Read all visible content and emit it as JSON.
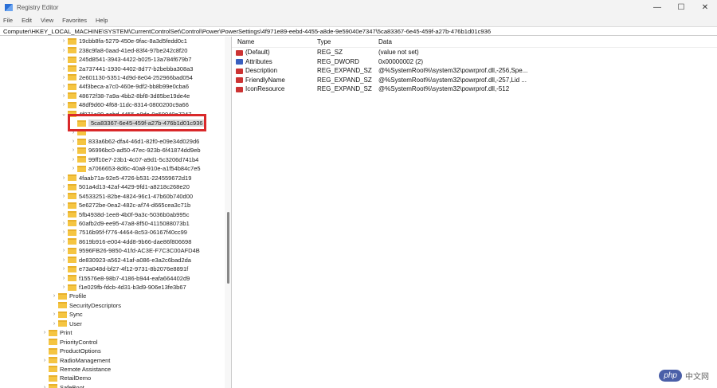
{
  "window": {
    "title": "Registry Editor",
    "controls": [
      "—",
      "☐",
      "✕"
    ]
  },
  "menu": [
    "File",
    "Edit",
    "View",
    "Favorites",
    "Help"
  ],
  "address": "Computer\\HKEY_LOCAL_MACHINE\\SYSTEM\\CurrentControlSet\\Control\\Power\\PowerSettings\\4f971e89-eebd-4455-a8de-9e59040e7347\\5ca83367-6e45-459f-a27b-476b1d01c936",
  "tree": [
    {
      "label": "19cbb8fa-5279-450e-9fac-8a3d5fedd0c1",
      "level": 3,
      "arrow": "›"
    },
    {
      "label": "238c9fa8-0aad-41ed-83f4-97be242c8f20",
      "level": 3,
      "arrow": "›"
    },
    {
      "label": "245d8541-3943-4422-b025-13a784f679b7",
      "level": 3,
      "arrow": "›"
    },
    {
      "label": "2a737441-1930-4402-8d77-b2bebba308a3",
      "level": 3,
      "arrow": "›"
    },
    {
      "label": "2e601130-5351-4d9d-8e04-252966bad054",
      "level": 3,
      "arrow": "›"
    },
    {
      "label": "44f3beca-a7c0-460e-9df2-bb8b99e0cba6",
      "level": 3,
      "arrow": "›"
    },
    {
      "label": "48672f38-7a9a-4bb2-8bf8-3d85be19de4e",
      "level": 3,
      "arrow": "›"
    },
    {
      "label": "48df9d60-4f68-11dc-8314-0800200c9a66",
      "level": 3,
      "arrow": "›"
    },
    {
      "label": "4f971e89-eebd-4455-a8de-9e59040e7347",
      "level": 3,
      "arrow": "⌄"
    },
    {
      "label": "5ca83367-6e45-459f-a27b-476b1d01c936",
      "level": 4,
      "arrow": "",
      "selected": true
    },
    {
      "label": "",
      "level": 4,
      "arrow": "›"
    },
    {
      "label": "833a6b62-dfa4-46d1-82f0-e09e34d029d6",
      "level": 4,
      "arrow": "›"
    },
    {
      "label": "96996bc0-ad50-47ec-923b-6f41874dd9eb",
      "level": 4,
      "arrow": "›"
    },
    {
      "label": "99ff10e7-23b1-4c07-a9d1-5c3206d741b4",
      "level": 4,
      "arrow": "›"
    },
    {
      "label": "a7066653-8d6c-40a8-910e-a1f54b84c7e5",
      "level": 4,
      "arrow": "›"
    },
    {
      "label": "4faab71a-92e5-4726-b531-224559672d19",
      "level": 3,
      "arrow": "›"
    },
    {
      "label": "501a4d13-42af-4429-9fd1-a8218c268e20",
      "level": 3,
      "arrow": "›"
    },
    {
      "label": "54533251-82be-4824-96c1-47b60b740d00",
      "level": 3,
      "arrow": "›"
    },
    {
      "label": "5e6272be-0ea2-482c-af74-d665cea3c71b",
      "level": 3,
      "arrow": "›"
    },
    {
      "label": "5fb4938d-1ee8-4b0f-9a3c-5036b0ab995c",
      "level": 3,
      "arrow": "›"
    },
    {
      "label": "60afb2d9-ee95-47a8-8f50-4115088073b1",
      "level": 3,
      "arrow": "›"
    },
    {
      "label": "7516b95f-f776-4464-8c53-06167f40cc99",
      "level": 3,
      "arrow": "›"
    },
    {
      "label": "8619b916-e004-4dd8-9b66-dae86f806698",
      "level": 3,
      "arrow": "›"
    },
    {
      "label": "9596FB26-9850-41fd-AC3E-F7C3C00AFD4B",
      "level": 3,
      "arrow": "›"
    },
    {
      "label": "de830923-a562-41af-a086-e3a2c6bad2da",
      "level": 3,
      "arrow": "›"
    },
    {
      "label": "e73a048d-bf27-4f12-9731-8b2076e8891f",
      "level": 3,
      "arrow": "›"
    },
    {
      "label": "f15576e8-98b7-4186-b944-eafa664402d9",
      "level": 3,
      "arrow": "›"
    },
    {
      "label": "f1e029fb-fdcb-4d31-b3d9-906e13fe3b67",
      "level": 3,
      "arrow": "›"
    },
    {
      "label": "Profile",
      "level": 2,
      "arrow": "›"
    },
    {
      "label": "SecurityDescriptors",
      "level": 2,
      "arrow": ""
    },
    {
      "label": "Sync",
      "level": 2,
      "arrow": "›"
    },
    {
      "label": "User",
      "level": 2,
      "arrow": "›"
    },
    {
      "label": "Print",
      "level": 1,
      "arrow": "›"
    },
    {
      "label": "PriorityControl",
      "level": 1,
      "arrow": ""
    },
    {
      "label": "ProductOptions",
      "level": 1,
      "arrow": ""
    },
    {
      "label": "RadioManagement",
      "level": 1,
      "arrow": "›"
    },
    {
      "label": "Remote Assistance",
      "level": 1,
      "arrow": ""
    },
    {
      "label": "RetailDemo",
      "level": 1,
      "arrow": ""
    },
    {
      "label": "SafeBoot",
      "level": 1,
      "arrow": "›"
    }
  ],
  "values": {
    "headers": [
      "Name",
      "Type",
      "Data"
    ],
    "rows": [
      {
        "name": "(Default)",
        "type": "REG_SZ",
        "data": "(value not set)",
        "icon": "string"
      },
      {
        "name": "Attributes",
        "type": "REG_DWORD",
        "data": "0x00000002 (2)",
        "icon": "binary"
      },
      {
        "name": "Description",
        "type": "REG_EXPAND_SZ",
        "data": "@%SystemRoot%\\system32\\powrprof.dll,-256,Spe...",
        "icon": "string"
      },
      {
        "name": "FriendlyName",
        "type": "REG_EXPAND_SZ",
        "data": "@%SystemRoot%\\system32\\powrprof.dll,-257,Lid ...",
        "icon": "string"
      },
      {
        "name": "IconResource",
        "type": "REG_EXPAND_SZ",
        "data": "@%SystemRoot%\\system32\\powrprof.dll,-512",
        "icon": "string"
      }
    ]
  },
  "watermark": {
    "logo": "php",
    "text": "中文网"
  }
}
